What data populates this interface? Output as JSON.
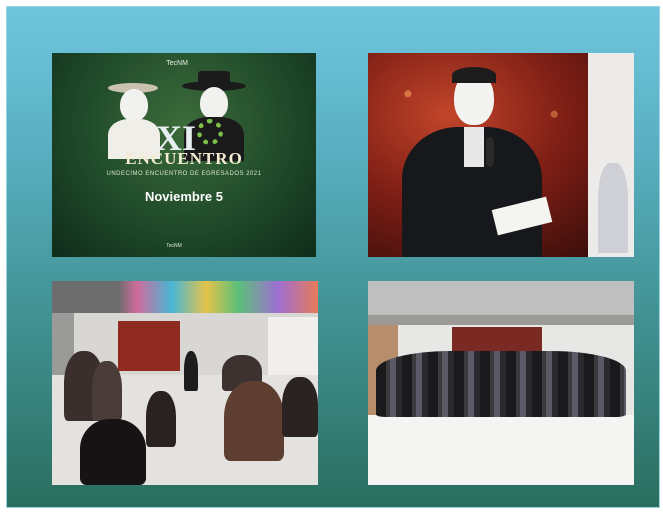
{
  "poster": {
    "logo_left": "TecNM",
    "logo_right": "",
    "title": "ENCUENTRO",
    "roman": "XI",
    "subtitle": "UNDECIMO ENCUENTRO DE EGRESADOS 2021",
    "date": "Noviembre 5",
    "venue": "",
    "footer_items": [
      "TecNM",
      "",
      ""
    ]
  },
  "colors": {
    "frame_top": "#6fc5dd",
    "frame_bottom": "#2a6e5f",
    "poster_green": "#1f4a2a",
    "stage_red": "#7e1e15"
  },
  "photos": [
    {
      "name": "event-poster"
    },
    {
      "name": "speaker-catrin-makeup"
    },
    {
      "name": "audience-seated-room"
    },
    {
      "name": "group-photo"
    }
  ]
}
